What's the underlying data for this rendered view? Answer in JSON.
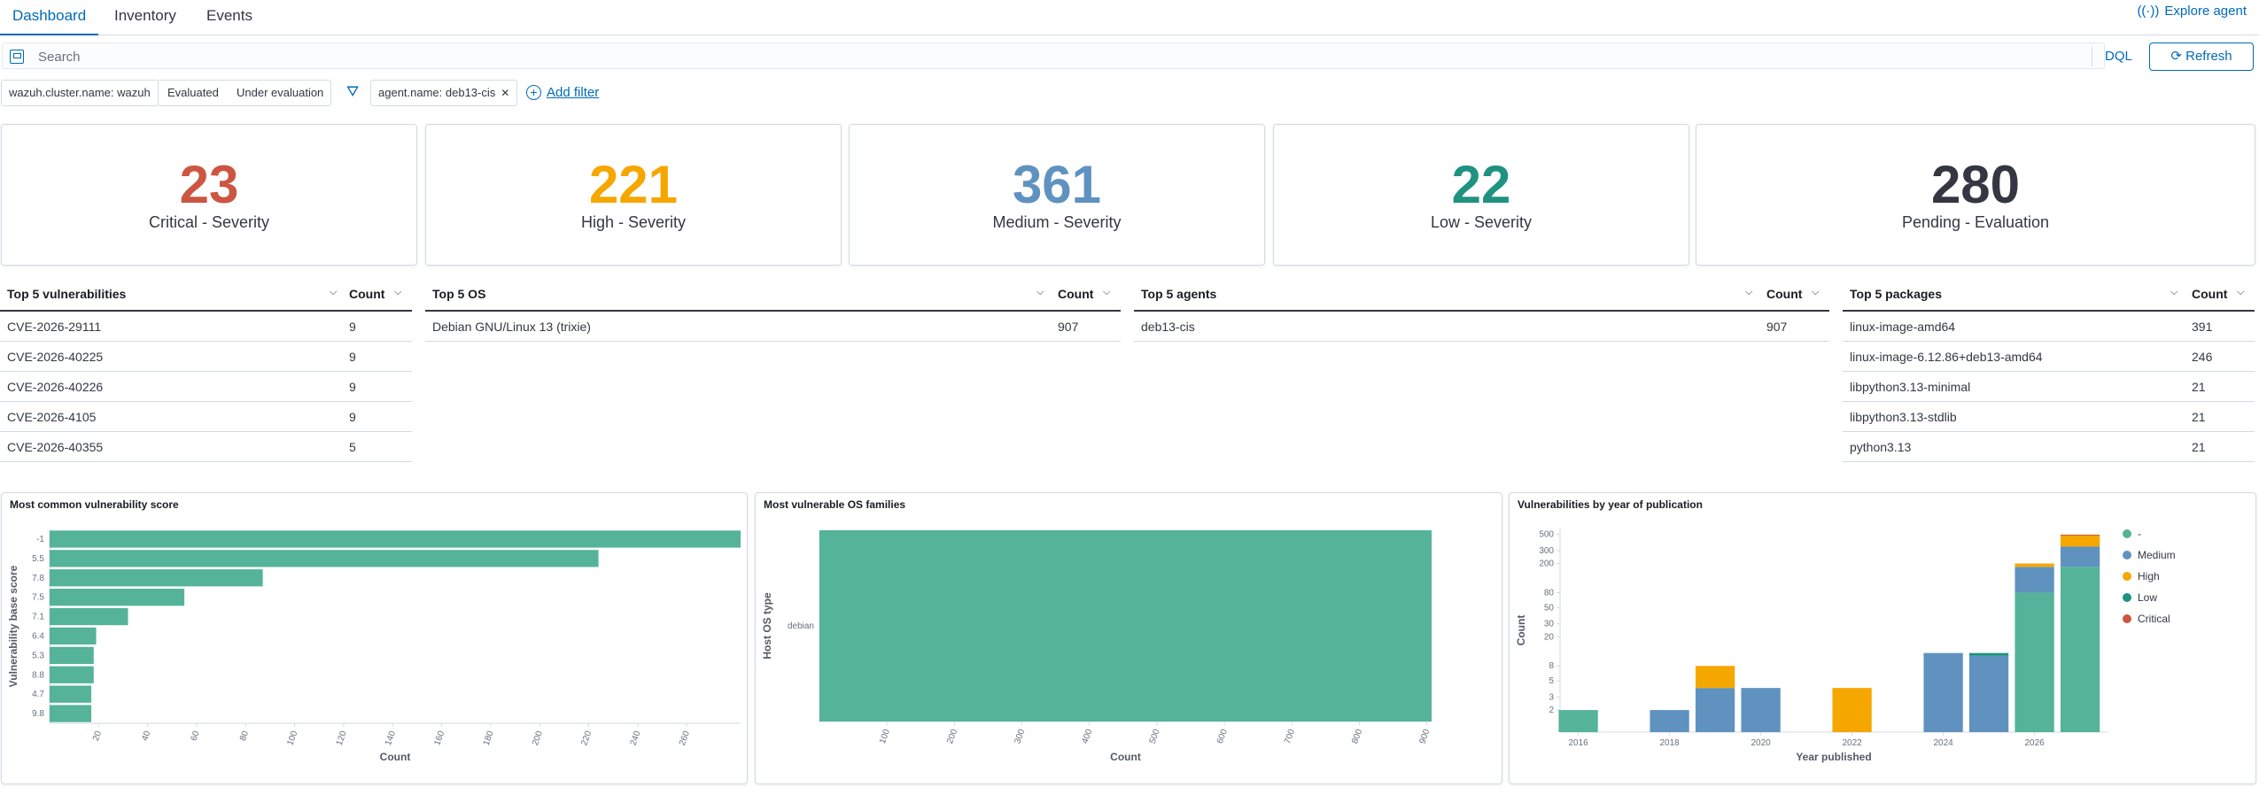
{
  "tabs": [
    "Dashboard",
    "Inventory",
    "Events"
  ],
  "explore_agent": "Explore agent",
  "search": {
    "placeholder": "Search",
    "dql": "DQL",
    "refresh": "Refresh"
  },
  "filters": {
    "cluster": "wazuh.cluster.name: wazuh",
    "evaluated": "Evaluated",
    "under_evaluation": "Under evaluation",
    "agent": "agent.name: deb13-cis",
    "add_filter": "Add filter"
  },
  "stats": [
    {
      "value": "23",
      "label": "Critical - Severity",
      "color": "#cc5642"
    },
    {
      "value": "221",
      "label": "High - Severity",
      "color": "#f5a700"
    },
    {
      "value": "361",
      "label": "Medium - Severity",
      "color": "#6092c0"
    },
    {
      "value": "22",
      "label": "Low - Severity",
      "color": "#209280"
    },
    {
      "value": "280",
      "label": "Pending - Evaluation",
      "color": "#343741"
    }
  ],
  "tables": {
    "vulnerabilities": {
      "title": "Top 5 vulnerabilities",
      "count": "Count",
      "rows": [
        {
          "name": "CVE-2026-29111",
          "count": "9"
        },
        {
          "name": "CVE-2026-40225",
          "count": "9"
        },
        {
          "name": "CVE-2026-40226",
          "count": "9"
        },
        {
          "name": "CVE-2026-4105",
          "count": "9"
        },
        {
          "name": "CVE-2026-40355",
          "count": "5"
        }
      ]
    },
    "os": {
      "title": "Top 5 OS",
      "count": "Count",
      "rows": [
        {
          "name": "Debian GNU/Linux 13 (trixie)",
          "count": "907"
        }
      ]
    },
    "agents": {
      "title": "Top 5 agents",
      "count": "Count",
      "rows": [
        {
          "name": "deb13-cis",
          "count": "907"
        }
      ]
    },
    "packages": {
      "title": "Top 5 packages",
      "count": "Count",
      "rows": [
        {
          "name": "linux-image-amd64",
          "count": "391"
        },
        {
          "name": "linux-image-6.12.86+deb13-amd64",
          "count": "246"
        },
        {
          "name": "libpython3.13-minimal",
          "count": "21"
        },
        {
          "name": "libpython3.13-stdlib",
          "count": "21"
        },
        {
          "name": "python3.13",
          "count": "21"
        }
      ]
    }
  },
  "chart_data": [
    {
      "type": "bar",
      "orientation": "horizontal",
      "title": "Most common vulnerability score",
      "xlabel": "Count",
      "ylabel": "Vulnerability base score",
      "categories": [
        "-1",
        "5.5",
        "7.8",
        "7.5",
        "7.1",
        "6.4",
        "5.3",
        "8.8",
        "4.7",
        "9.8"
      ],
      "values": [
        282,
        224,
        87,
        55,
        32,
        19,
        18,
        18,
        17,
        17
      ],
      "xlim": [
        0,
        282
      ],
      "xticks": [
        20,
        40,
        60,
        80,
        100,
        120,
        140,
        160,
        180,
        200,
        220,
        240,
        260
      ],
      "color": "#54b399"
    },
    {
      "type": "bar",
      "orientation": "horizontal",
      "title": "Most vulnerable OS families",
      "xlabel": "Count",
      "ylabel": "Host OS type",
      "categories": [
        "debian"
      ],
      "values": [
        907
      ],
      "xlim": [
        0,
        907
      ],
      "xticks": [
        100,
        200,
        300,
        400,
        500,
        600,
        700,
        800,
        900
      ],
      "color": "#54b399"
    },
    {
      "type": "bar",
      "stacked": true,
      "yscale": "log",
      "title": "Vulnerabilities by year of publication",
      "xlabel": "Year published",
      "ylabel": "Count",
      "x": [
        2016,
        2018,
        2019,
        2020,
        2022,
        2024,
        2025,
        2026,
        2027
      ],
      "xticks": [
        2016,
        2018,
        2020,
        2022,
        2024,
        2026
      ],
      "yticks": [
        2,
        3,
        5,
        8,
        20,
        30,
        50,
        80,
        200,
        300,
        500
      ],
      "ylim": [
        1,
        600
      ],
      "series": [
        {
          "name": "-",
          "color": "#54b399",
          "values": [
            2,
            0,
            0,
            0,
            0,
            0,
            0,
            80,
            180
          ]
        },
        {
          "name": "Medium",
          "color": "#6092c0",
          "values": [
            0,
            2,
            4,
            4,
            0,
            12,
            11,
            100,
            160
          ]
        },
        {
          "name": "High",
          "color": "#f5a700",
          "values": [
            0,
            0,
            4,
            0,
            4,
            0,
            0,
            20,
            150
          ]
        },
        {
          "name": "Low",
          "color": "#209280",
          "values": [
            0,
            0,
            0,
            0,
            0,
            0,
            1,
            0,
            0
          ]
        },
        {
          "name": "Critical",
          "color": "#cc5642",
          "values": [
            0,
            0,
            0,
            0,
            0,
            0,
            0,
            0,
            5
          ]
        }
      ]
    }
  ]
}
